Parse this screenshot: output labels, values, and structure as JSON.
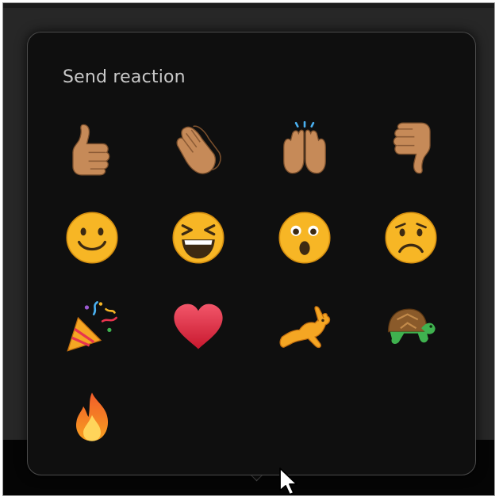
{
  "popup": {
    "title": "Send reaction"
  },
  "reactions": [
    {
      "name": "like",
      "icon": "thumbs-up-icon"
    },
    {
      "name": "clap",
      "icon": "clapping-hands-icon"
    },
    {
      "name": "celebrate",
      "icon": "raised-hands-icon"
    },
    {
      "name": "dislike",
      "icon": "thumbs-down-icon"
    },
    {
      "name": "smile",
      "icon": "smiling-face-icon"
    },
    {
      "name": "laugh",
      "icon": "laughing-face-icon"
    },
    {
      "name": "surprised",
      "icon": "surprised-face-icon"
    },
    {
      "name": "sad",
      "icon": "frowning-face-icon"
    },
    {
      "name": "party",
      "icon": "party-popper-icon"
    },
    {
      "name": "love",
      "icon": "red-heart-icon"
    },
    {
      "name": "speed-up",
      "icon": "rabbit-icon"
    },
    {
      "name": "slow-down",
      "icon": "turtle-icon"
    },
    {
      "name": "fire",
      "icon": "fire-icon"
    }
  ],
  "colors": {
    "popup_bg": "#0f0f0f",
    "popup_border": "#4b4b4b",
    "title_text": "#c9c9c9",
    "skin_tone": "#c68a58",
    "emoji_yellow": "#f7b625",
    "heart_red": "#e8344e",
    "turtle_green": "#3fb24f"
  }
}
